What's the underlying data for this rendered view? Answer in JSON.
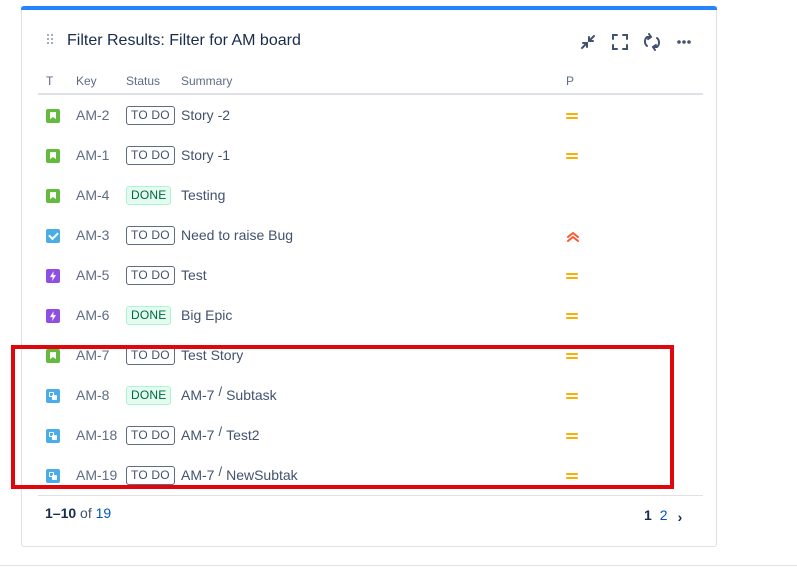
{
  "gadget": {
    "title": "Filter Results: Filter for AM board",
    "accent_color": "#2684ff",
    "actions": [
      {
        "name": "minimize-icon"
      },
      {
        "name": "fullscreen-icon"
      },
      {
        "name": "refresh-icon"
      },
      {
        "name": "more-icon"
      }
    ]
  },
  "table": {
    "columns": [
      "T",
      "Key",
      "Status",
      "Summary",
      "P"
    ],
    "rows": [
      {
        "type": "story",
        "key": "AM-2",
        "status": "TO DO",
        "parent": "",
        "summary": "Story -2",
        "priority": "medium"
      },
      {
        "type": "story",
        "key": "AM-1",
        "status": "TO DO",
        "parent": "",
        "summary": "Story -1",
        "priority": "medium"
      },
      {
        "type": "story",
        "key": "AM-4",
        "status": "DONE",
        "parent": "",
        "summary": "Testing",
        "priority": ""
      },
      {
        "type": "task",
        "key": "AM-3",
        "status": "TO DO",
        "parent": "",
        "summary": "Need to raise Bug",
        "priority": "highest"
      },
      {
        "type": "epic",
        "key": "AM-5",
        "status": "TO DO",
        "parent": "",
        "summary": "Test",
        "priority": "medium"
      },
      {
        "type": "epic",
        "key": "AM-6",
        "status": "DONE",
        "parent": "",
        "summary": "Big Epic",
        "priority": "medium"
      },
      {
        "type": "story",
        "key": "AM-7",
        "status": "TO DO",
        "parent": "",
        "summary": "Test Story",
        "priority": "medium"
      },
      {
        "type": "subtask",
        "key": "AM-8",
        "status": "DONE",
        "parent": "AM-7",
        "summary": "Subtask",
        "priority": "medium"
      },
      {
        "type": "subtask",
        "key": "AM-18",
        "status": "TO DO",
        "parent": "AM-7",
        "summary": "Test2",
        "priority": "medium"
      },
      {
        "type": "subtask",
        "key": "AM-19",
        "status": "TO DO",
        "parent": "AM-7",
        "summary": "NewSubtak",
        "priority": "medium"
      }
    ]
  },
  "footer": {
    "range": "1–10",
    "of": "of",
    "total": "19",
    "pages": [
      "1",
      "2"
    ],
    "next": "›"
  },
  "colors": {
    "highlight_box": "#e0060b",
    "priority_medium": "#ffab00",
    "priority_highest": "#ff5630"
  }
}
